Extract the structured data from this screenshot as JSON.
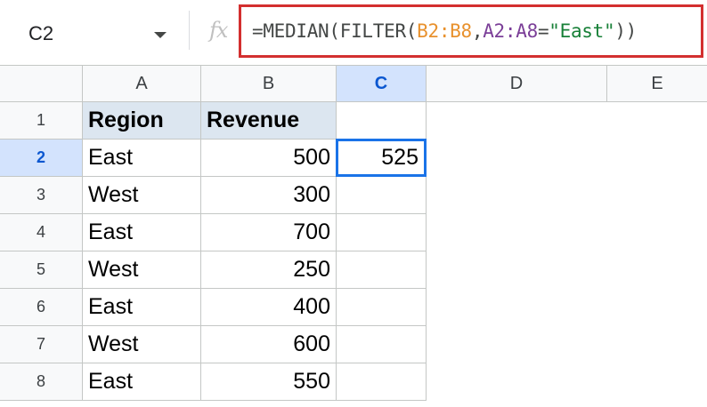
{
  "formula_bar": {
    "name_box": "C2",
    "fx_label": "fx",
    "formula_parts": {
      "p1": "=MEDIAN(FILTER(",
      "ref1": "B2:B8",
      "p2": ",",
      "ref2": "A2:A8",
      "p3": "=",
      "str": "\"East\"",
      "p4": "))"
    }
  },
  "columns": [
    "A",
    "B",
    "C",
    "D",
    "E"
  ],
  "rows": [
    "1",
    "2",
    "3",
    "4",
    "5",
    "6",
    "7",
    "8"
  ],
  "cells": {
    "A1": "Region",
    "B1": "Revenue",
    "A2": "East",
    "B2": "500",
    "C2": "525",
    "A3": "West",
    "B3": "300",
    "A4": "East",
    "B4": "700",
    "A5": "West",
    "B5": "250",
    "A6": "East",
    "B6": "400",
    "A7": "West",
    "B7": "600",
    "A8": "East",
    "B8": "550"
  },
  "colors": {
    "formula_highlight": "#d32f2f",
    "active_cell": "#1a73e8",
    "selected_header": "#d3e3fd",
    "range_ref_1": "#e8912d",
    "range_ref_2": "#7b3f98",
    "string_literal": "#188038"
  }
}
